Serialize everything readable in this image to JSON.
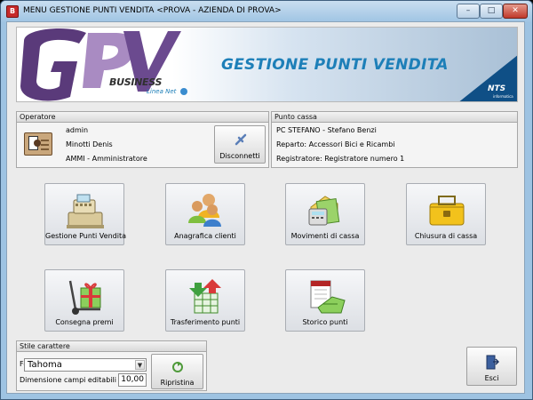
{
  "window": {
    "title": "MENU GESTIONE PUNTI VENDITA <PROVA - AZIENDA DI PROVA>",
    "app_icon": "app-icon-red",
    "controls": {
      "minimize": "minimize-icon",
      "maximize": "maximize-icon",
      "close": "close-icon"
    }
  },
  "banner": {
    "logo_letters": "GPV",
    "business": "BUSINESS",
    "linea": "Linea Net",
    "title": "GESTIONE PUNTI VENDITA",
    "brand": "NTS",
    "brand_sub": "informatica",
    "colors": {
      "gpv": "#5a3a7a",
      "title": "#1d7fb8",
      "corner": "#0f4f86"
    }
  },
  "operatore": {
    "header": "Operatore",
    "username": "admin",
    "full_name": "Minotti Denis",
    "role": "AMMI - Amministratore",
    "disconnect_label": "Disconnetti",
    "avatar_icon": "operator-badge-icon"
  },
  "punto_cassa": {
    "header": "Punto cassa",
    "pc": "PC STEFANO - Stefano Benzi",
    "reparto": "Reparto: Accessori Bici e Ricambi",
    "registratore": "Registratore: Registratore numero 1"
  },
  "tiles": [
    {
      "label": "Gestione Punti Vendita",
      "icon": "cash-register-icon"
    },
    {
      "label": "Anagrafica clienti",
      "icon": "customers-icon"
    },
    {
      "label": "Movimenti di cassa",
      "icon": "cash-movements-icon"
    },
    {
      "label": "Chiusura di cassa",
      "icon": "cash-box-icon"
    },
    {
      "label": "Consegna premi",
      "icon": "gift-trolley-icon"
    },
    {
      "label": "Trasferimento punti",
      "icon": "transfer-points-icon"
    },
    {
      "label": "Storico punti",
      "icon": "points-history-icon"
    }
  ],
  "stile": {
    "header": "Stile carattere",
    "font_label": "Font",
    "font_value": "Tahoma",
    "size_label": "Dimensione campi editabili",
    "size_value": "10,00",
    "reset_label": "Ripristina",
    "reset_icon": "reset-icon"
  },
  "exit": {
    "label": "Esci",
    "icon": "exit-door-icon"
  }
}
